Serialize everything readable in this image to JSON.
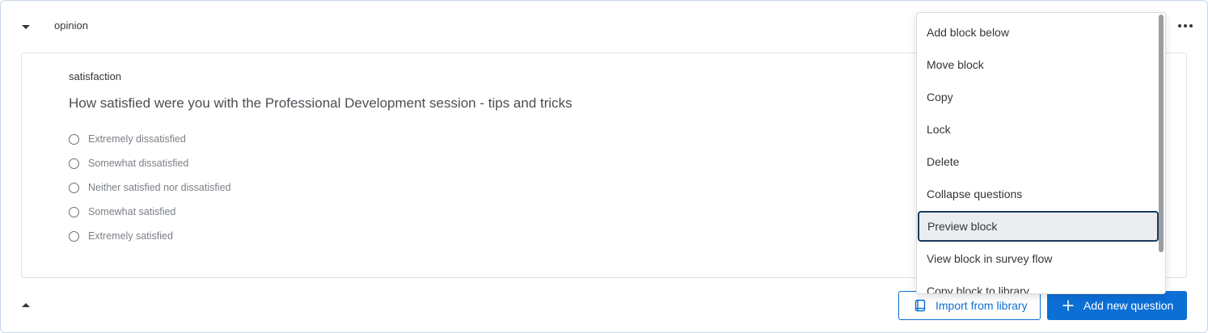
{
  "block": {
    "title": "opinion"
  },
  "question": {
    "export_tag": "satisfaction",
    "text": "How satisfied were you with the Professional Development session - tips and tricks",
    "choices": [
      "Extremely dissatisfied",
      "Somewhat dissatisfied",
      "Neither satisfied nor dissatisfied",
      "Somewhat satisfied",
      "Extremely satisfied"
    ]
  },
  "footer": {
    "import_label": "Import from library",
    "add_label": "Add new question"
  },
  "menu": {
    "items": [
      "Add block below",
      "Move block",
      "Copy",
      "Lock",
      "Delete",
      "Collapse questions",
      "Preview block",
      "View block in survey flow",
      "Copy block to library"
    ],
    "focused_item": "Preview block"
  },
  "icons": {
    "collapse": "caret-down-icon",
    "expand": "caret-up-icon",
    "more": "more-horizontal-icon",
    "import": "book-icon",
    "add": "plus-icon"
  },
  "colors": {
    "accent": "#0b6fd6",
    "focus_border": "#1a3a5c",
    "frame_border": "#c9d7e8"
  }
}
